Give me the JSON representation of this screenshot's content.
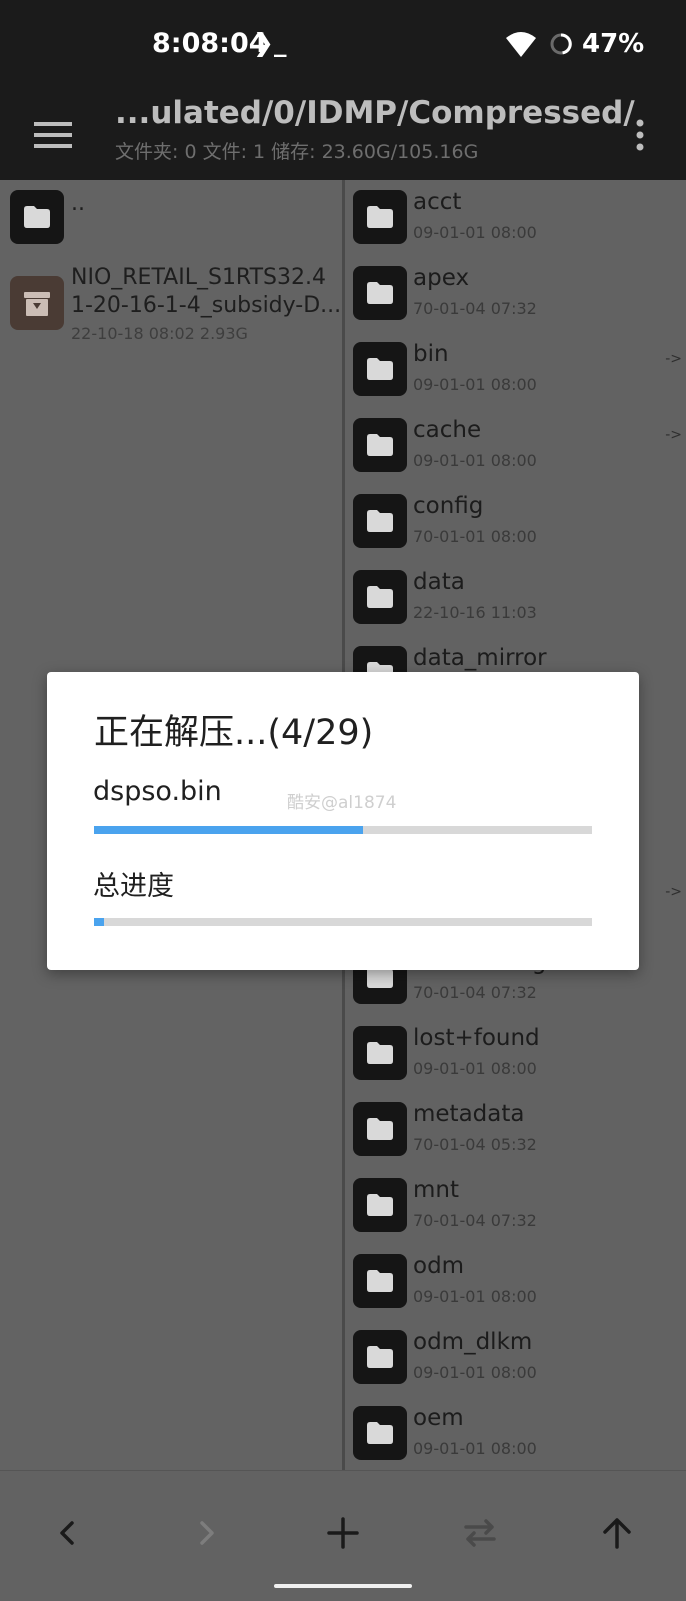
{
  "status_bar": {
    "time": "8:08:04",
    "terminal_glyph": "❯_",
    "battery_percent": "47%",
    "icons": [
      "wifi-icon",
      "battery-ring-icon"
    ]
  },
  "app_bar": {
    "path": "...ulated/0/IDMP/Compressed/",
    "stats": "文件夹: 0  文件: 1  储存: 23.60G/105.16G"
  },
  "left_pane": {
    "parent_label": "..",
    "file": {
      "name_line1": "NIO_RETAIL_S1RTS32.4",
      "name_line2": "1-20-16-1-4_subsidy-D...",
      "meta": "22-10-18 08:02  2.93G"
    }
  },
  "right_pane": {
    "items": [
      {
        "name": "acct",
        "date": "09-01-01 08:00",
        "link": ""
      },
      {
        "name": "apex",
        "date": "70-01-04 07:32",
        "link": ""
      },
      {
        "name": "bin",
        "date": "09-01-01 08:00",
        "link": "->"
      },
      {
        "name": "cache",
        "date": "09-01-01 08:00",
        "link": "->"
      },
      {
        "name": "config",
        "date": "70-01-01 08:00",
        "link": ""
      },
      {
        "name": "data",
        "date": "22-10-16 11:03",
        "link": ""
      },
      {
        "name": "data_mirror",
        "date": "",
        "link": ""
      },
      {
        "name": "linkerconfig",
        "date": "70-01-04 07:32",
        "link": ""
      },
      {
        "name": "lost+found",
        "date": "09-01-01 08:00",
        "link": ""
      },
      {
        "name": "metadata",
        "date": "70-01-04 05:32",
        "link": ""
      },
      {
        "name": "mnt",
        "date": "70-01-04 07:32",
        "link": ""
      },
      {
        "name": "odm",
        "date": "09-01-01 08:00",
        "link": ""
      },
      {
        "name": "odm_dlkm",
        "date": "09-01-01 08:00",
        "link": ""
      },
      {
        "name": "oem",
        "date": "09-01-01 08:00",
        "link": ""
      }
    ],
    "hidden_row_link": "->"
  },
  "dialog": {
    "title": "正在解压...(4/29)",
    "current_file": "dspso.bin",
    "current_progress": 0.54,
    "total_label": "总进度",
    "total_progress": 0.02,
    "watermark": "酷安@al1874",
    "accent_color": "#4aa3ee"
  },
  "bottom_bar": {
    "buttons": [
      "back-icon",
      "forward-icon",
      "add-icon",
      "swap-icon",
      "up-icon"
    ]
  }
}
